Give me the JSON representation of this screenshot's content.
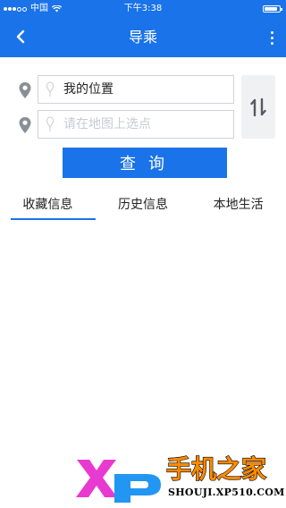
{
  "status_bar": {
    "carrier": "中国",
    "time": "下午3:38",
    "battery_level": 0.85
  },
  "nav": {
    "title": "导乘",
    "back_icon": "chevron-left-icon",
    "more_icon": "more-vertical-icon"
  },
  "search": {
    "start_value": "我的位置",
    "end_placeholder": "请在地图上选点",
    "query_label": "查询",
    "swap_icon": "swap-vertical-icon"
  },
  "tabs": [
    {
      "label": "收藏信息",
      "active": true
    },
    {
      "label": "历史信息",
      "active": false
    },
    {
      "label": "本地生活",
      "active": false
    }
  ],
  "watermark": {
    "brand": "手机之家",
    "site": "SHOUJI.XP510.COM"
  },
  "colors": {
    "primary": "#1a73e8",
    "field_border": "#cfd3d8",
    "placeholder": "#c7ccd2",
    "pin": "#8a8f96",
    "brand_orange": "#ff8a00"
  }
}
